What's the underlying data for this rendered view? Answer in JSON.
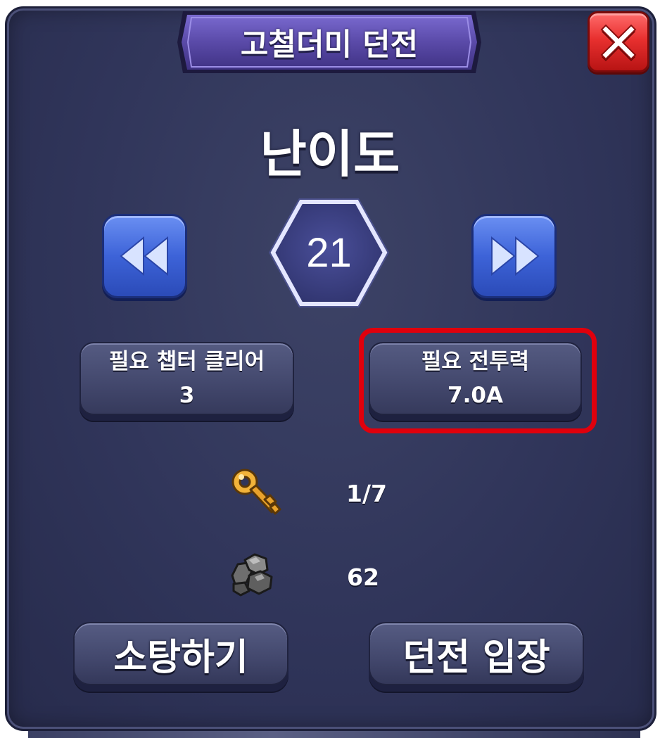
{
  "dialog": {
    "title": "고철더미 던전",
    "difficulty_label": "난이도",
    "difficulty_level": "21"
  },
  "requirements": {
    "chapter_label": "필요 챕터 클리어",
    "chapter_value": "3",
    "power_label": "필요 전투력",
    "power_value": "7.0A"
  },
  "resources": {
    "keys": "1/7",
    "scrap": "62"
  },
  "actions": {
    "sweep_label": "소탕하기",
    "enter_label": "던전 입장"
  },
  "colors": {
    "panel": "#30355a",
    "title_banner": "#5a4aa8",
    "arrow_button": "#3d63d8",
    "close_button": "#e8302f",
    "highlight": "#e0000c"
  },
  "icons": {
    "close": "close-x-icon",
    "prev": "double-chevron-left-icon",
    "next": "double-chevron-right-icon",
    "key": "gold-key-icon",
    "scrap": "scrap-ore-icon"
  }
}
